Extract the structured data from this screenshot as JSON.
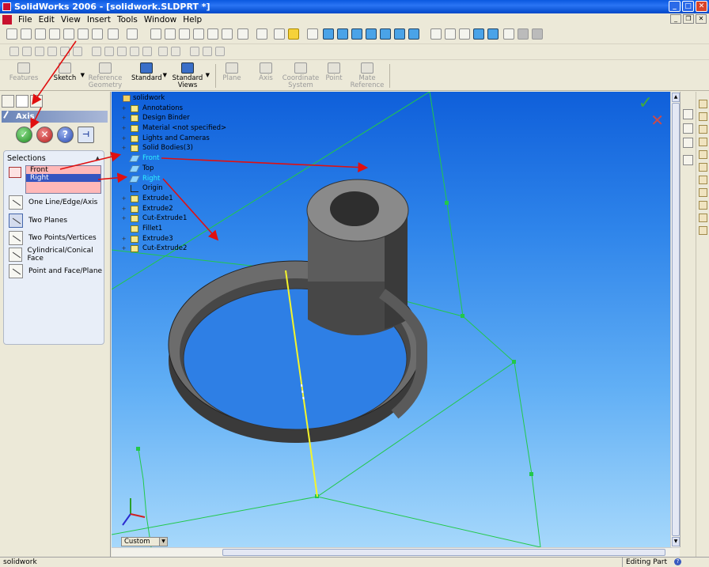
{
  "window": {
    "title": "SolidWorks 2006 - [solidwork.SLDPRT *]"
  },
  "menu": {
    "items": [
      "File",
      "Edit",
      "View",
      "Insert",
      "Tools",
      "Window",
      "Help"
    ]
  },
  "command_manager": {
    "items": [
      {
        "label": "Features",
        "enabled": false
      },
      {
        "label": "Sketch",
        "enabled": true
      },
      {
        "label": "Reference Geometry",
        "enabled": false
      },
      {
        "label": "Standard",
        "enabled": true
      },
      {
        "label": "Standard Views",
        "enabled": true
      },
      {
        "label": "Plane",
        "enabled": false
      },
      {
        "label": "Axis",
        "enabled": false
      },
      {
        "label": "Coordinate System",
        "enabled": false
      },
      {
        "label": "Point",
        "enabled": false
      },
      {
        "label": "Mate Reference",
        "enabled": false
      }
    ]
  },
  "property_manager": {
    "title": "Axis",
    "buttons": {
      "ok": "✓",
      "cancel": "✕",
      "help": "?",
      "pin": "⊣"
    },
    "selections_label": "Selections",
    "selections": [
      "Front",
      "Right"
    ],
    "options": [
      {
        "label": "One Line/Edge/Axis",
        "selected": false
      },
      {
        "label": "Two Planes",
        "selected": true
      },
      {
        "label": "Two Points/Vertices",
        "selected": false
      },
      {
        "label": "Cylindrical/Conical Face",
        "selected": false
      },
      {
        "label": "Point and Face/Plane",
        "selected": false
      }
    ]
  },
  "feature_tree": {
    "root": "solidwork",
    "items": [
      {
        "label": "Annotations",
        "kind": "feat",
        "expandable": true,
        "selected": false
      },
      {
        "label": "Design Binder",
        "kind": "feat",
        "expandable": true,
        "selected": false
      },
      {
        "label": "Material <not specified>",
        "kind": "feat",
        "expandable": true,
        "selected": false
      },
      {
        "label": "Lights and Cameras",
        "kind": "feat",
        "expandable": true,
        "selected": false
      },
      {
        "label": "Solid Bodies(3)",
        "kind": "feat",
        "expandable": true,
        "selected": false
      },
      {
        "label": "Front",
        "kind": "plane",
        "expandable": false,
        "selected": true
      },
      {
        "label": "Top",
        "kind": "plane",
        "expandable": false,
        "selected": false
      },
      {
        "label": "Right",
        "kind": "plane",
        "expandable": false,
        "selected": true
      },
      {
        "label": "Origin",
        "kind": "origin",
        "expandable": false,
        "selected": false
      },
      {
        "label": "Extrude1",
        "kind": "feat",
        "expandable": true,
        "selected": false
      },
      {
        "label": "Extrude2",
        "kind": "feat",
        "expandable": true,
        "selected": false
      },
      {
        "label": "Cut-Extrude1",
        "kind": "feat",
        "expandable": true,
        "selected": false
      },
      {
        "label": "Fillet1",
        "kind": "feat",
        "expandable": false,
        "selected": false
      },
      {
        "label": "Extrude3",
        "kind": "feat",
        "expandable": true,
        "selected": false
      },
      {
        "label": "Cut-Extrude2",
        "kind": "feat",
        "expandable": true,
        "selected": false
      }
    ]
  },
  "viewport": {
    "view_orientation": "Custom",
    "confirm_ok": "✓",
    "confirm_cancel": "✕"
  },
  "status": {
    "left": "solidwork",
    "mode": "Editing Part",
    "help": "?"
  },
  "colors": {
    "viewport_top": "#0f5fda",
    "viewport_bottom": "#a6d8fb",
    "selection_highlight": "#3655c0",
    "selection_list_bg": "#ffb8b8",
    "selected_tree_text": "#2ff2ff",
    "annotation_arrow": "#e01010",
    "plane_outline": "#20c840",
    "axis_preview": "#f0f020"
  }
}
